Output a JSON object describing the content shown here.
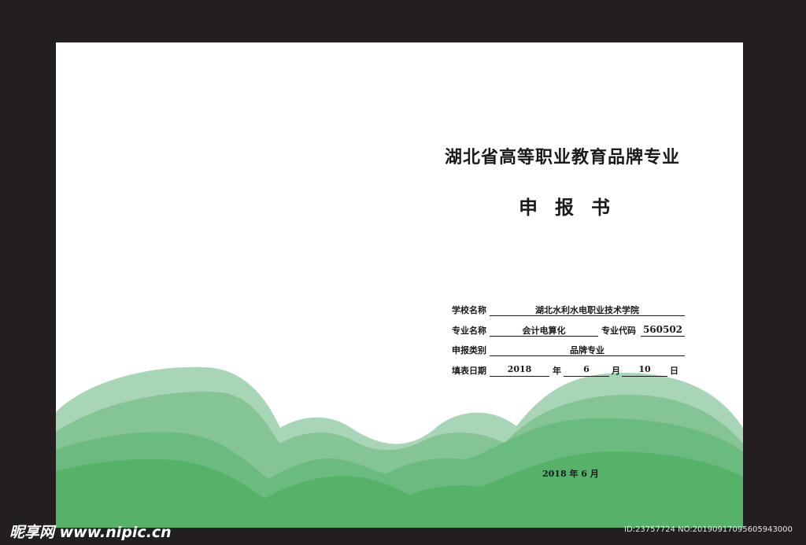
{
  "cover": {
    "title": "湖北省高等职业教育品牌专业",
    "subtitle": "申报书",
    "date": "2018 年 6 月"
  },
  "form": {
    "school_label": "学校名称",
    "school_value": "湖北水利水电职业技术学院",
    "major_label": "专业名称",
    "major_value": "会计电算化",
    "code_label": "专业代码",
    "code_value": "560502",
    "category_label": "申报类别",
    "category_value": "品牌专业",
    "fill_date_label": "填表日期",
    "year_value": "2018",
    "year_unit": "年",
    "month_value": "6",
    "month_unit": "月",
    "day_value": "10",
    "day_unit": "日"
  },
  "watermark": {
    "site": "昵享网 www.nipic.cn",
    "id_text": "ID:23757724 NO:20190917095605943000"
  },
  "colors": {
    "background": "#231f20",
    "page": "#ffffff",
    "hill_light": "#a8d5b5",
    "hill_mid": "#84c495",
    "hill_dark": "#6bbb80",
    "hill_front": "#55b268"
  }
}
